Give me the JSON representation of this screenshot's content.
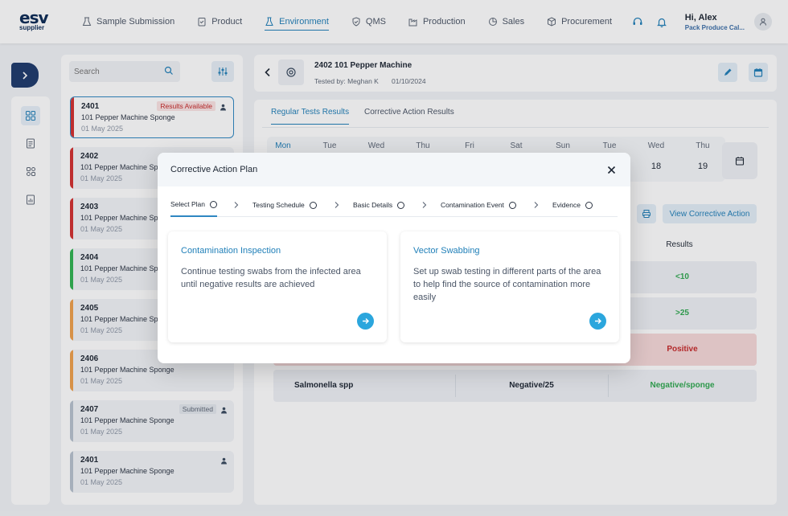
{
  "brand": {
    "logo_main": "esv",
    "logo_sub": "supplier"
  },
  "nav": [
    {
      "label": "Sample Submission",
      "icon": "beaker-icon"
    },
    {
      "label": "Product",
      "icon": "clipboard-icon"
    },
    {
      "label": "Environment",
      "icon": "flask-icon",
      "active": true
    },
    {
      "label": "QMS",
      "icon": "shield-icon"
    },
    {
      "label": "Production",
      "icon": "factory-icon"
    },
    {
      "label": "Sales",
      "icon": "chart-icon"
    },
    {
      "label": "Procurement",
      "icon": "box-icon"
    }
  ],
  "user": {
    "greeting": "Hi, Alex",
    "org": "Pack Produce Cal..."
  },
  "search": {
    "placeholder": "Search"
  },
  "samples": [
    {
      "id": "2401",
      "name": "101 Pepper Machine Sponge",
      "date": "01 May 2025",
      "badge": "Results Available",
      "bar_color": "#d32f2f",
      "selected": true
    },
    {
      "id": "2402",
      "name": "101 Pepper Machine Sponge",
      "date": "01 May 2025",
      "badge": "",
      "bar_color": "#d32f2f"
    },
    {
      "id": "2403",
      "name": "101 Pepper Machine Sponge",
      "date": "01 May 2025",
      "badge": "",
      "bar_color": "#d32f2f"
    },
    {
      "id": "2404",
      "name": "101 Pepper Machine Sponge",
      "date": "01 May 2025",
      "badge": "",
      "bar_color": "#2fb350"
    },
    {
      "id": "2405",
      "name": "101 Pepper Machine Sponge",
      "date": "01 May 2025",
      "badge": "",
      "bar_color": "#f0a04b"
    },
    {
      "id": "2406",
      "name": "101 Pepper Machine Sponge",
      "date": "01 May 2025",
      "badge": "",
      "bar_color": "#f0a04b"
    },
    {
      "id": "2407",
      "name": "101 Pepper Machine Sponge",
      "date": "01 May 2025",
      "badge": "Submitted",
      "bar_color": "#b8c2cf"
    },
    {
      "id": "2401",
      "name": "101 Pepper Machine Sponge",
      "date": "01 May 2025",
      "badge": "",
      "bar_color": "#b8c2cf"
    }
  ],
  "header": {
    "title": "2402 101 Pepper Machine",
    "tested_by": "Tested by: Meghan K",
    "date": "01/10/2024"
  },
  "tabs": [
    "Regular Tests Results",
    "Corrective Action Results"
  ],
  "calendar": [
    {
      "day": "Mon",
      "date": "",
      "active": true
    },
    {
      "day": "Tue",
      "date": ""
    },
    {
      "day": "Wed",
      "date": ""
    },
    {
      "day": "Thu",
      "date": ""
    },
    {
      "day": "Fri",
      "date": ""
    },
    {
      "day": "Sat",
      "date": ""
    },
    {
      "day": "Sun",
      "date": ""
    },
    {
      "day": "Tue",
      "date": ""
    },
    {
      "day": "Wed",
      "date": "18"
    },
    {
      "day": "Thu",
      "date": "19"
    }
  ],
  "actions": {
    "view_corrective": "View Corrective Action"
  },
  "results": {
    "header": "Results",
    "rows": [
      {
        "test": "",
        "value": "",
        "result": "<10",
        "result_color": "#2fa84f",
        "bg": "#eef1f5"
      },
      {
        "test": "",
        "value": "",
        "result": ">25",
        "result_color": "#2fa84f",
        "bg": "#eef1f5"
      },
      {
        "test": "",
        "value": "",
        "result": "Positive",
        "result_color": "#c62828",
        "bg": "#f6d9d9"
      },
      {
        "test": "Salmonella spp",
        "value": "Negative/25",
        "result": "Negative/sponge",
        "result_color": "#2fa84f",
        "bg": "#eef1f5"
      }
    ]
  },
  "modal": {
    "title": "Corrective Action Plan",
    "steps": [
      "Select Plan",
      "Testing Schedule",
      "Basic Details",
      "Contamination Event",
      "Evidence"
    ],
    "plans": [
      {
        "title": "Contamination Inspection",
        "description": "Continue testing swabs from the infected area until negative results are achieved"
      },
      {
        "title": "Vector Swabbing",
        "description": "Set up swab testing in different parts of the area to help find the source of contamination more easily"
      }
    ]
  },
  "colors": {
    "accent": "#1f7fb8",
    "navy": "#1d3a6b",
    "go_button": "#2ba6dd"
  }
}
